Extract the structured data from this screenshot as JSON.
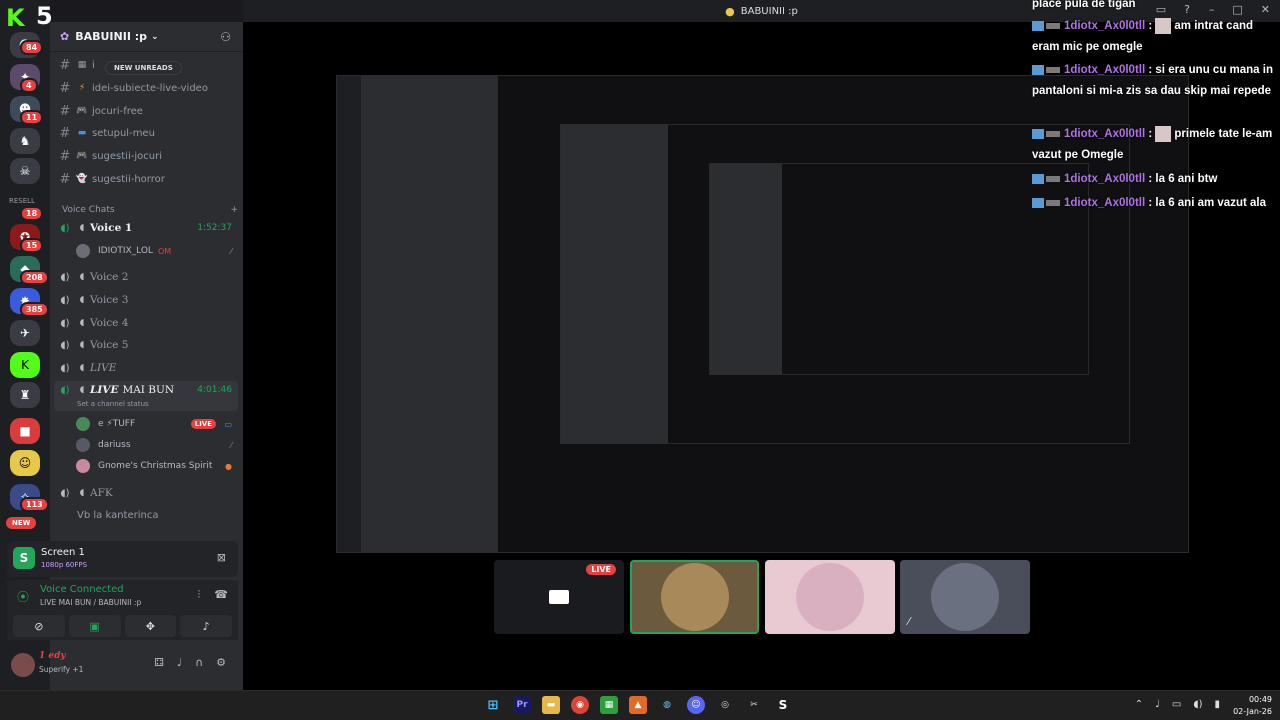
{
  "window": {
    "title": "BABUINII :p"
  },
  "rail": {
    "kick_text": "K",
    "kick_count": "5",
    "badges": [
      "84",
      "4",
      "11",
      "18",
      "15",
      "208",
      "385",
      "113"
    ],
    "resell_label": "RESELL",
    "new_label": "NEW"
  },
  "guild": {
    "name": "BABUINII :p"
  },
  "new_unreads": "NEW UNREADS",
  "channels": [
    {
      "emoji": "▦",
      "name": "i"
    },
    {
      "emoji": "⚡",
      "name": "idei-subiecte-live-video"
    },
    {
      "emoji": "🎮",
      "name": "jocuri-free"
    },
    {
      "emoji": "▬",
      "name": "setupul-meu"
    },
    {
      "emoji": "🎮",
      "name": "sugestii-jocuri"
    },
    {
      "emoji": "👻",
      "name": "sugestii-horror"
    }
  ],
  "voice_category": "Voice Chats",
  "voice_channels": {
    "voice1": {
      "name": "Voice 1",
      "timer": "1:52:37"
    },
    "voice2": "Voice 2",
    "voice3": "Voice 3",
    "voice4": "Voice 4",
    "voice5": "Voice 5",
    "live": "LIVE",
    "live_mai_bun": {
      "name_italic": "LIVE",
      "name_rest": "MAI BUN",
      "timer": "4:01:46",
      "status": "Set a channel status"
    },
    "afk": "AFK"
  },
  "voice1_member": {
    "name": "IDIOTIX_LOL",
    "tag": "OM"
  },
  "live_members": [
    {
      "name": "e ⚡TUFF",
      "live": "LIVE"
    },
    {
      "name": "dariuss"
    },
    {
      "name": "Gnome's Christmas Spirit"
    }
  ],
  "text_channel_bottom": "Vb la kanterinca",
  "screen_share": {
    "title": "Screen 1",
    "quality": "1080p 60FPS"
  },
  "voice_connection": {
    "status": "Voice Connected",
    "location": "LIVE MAI BUN / BABUINII :p"
  },
  "user": {
    "name": "1 edy",
    "status": "Superify +1"
  },
  "tiles": {
    "live_badge": "LIVE"
  },
  "chat": [
    {
      "user": "",
      "text": "place pula de tigan"
    },
    {
      "user": "1diotx_Ax0l0tll",
      "text": "am intrat cand eram mic pe omegle"
    },
    {
      "user": "1diotx_Ax0l0tll",
      "text": "si era unu cu mana in pantaloni si mi-a zis sa dau skip mai repede"
    },
    {
      "user": "1diotx_Ax0l0tll",
      "text": "primele tate le-am vazut pe Omegle"
    },
    {
      "user": "1diotx_Ax0l0tll",
      "text": "la 6 ani btw"
    },
    {
      "user": "1diotx_Ax0l0tll",
      "text": "la 6 ani am vazut ala"
    }
  ],
  "taskbar": {
    "time": "00:49",
    "date": "02-Jan-26"
  }
}
